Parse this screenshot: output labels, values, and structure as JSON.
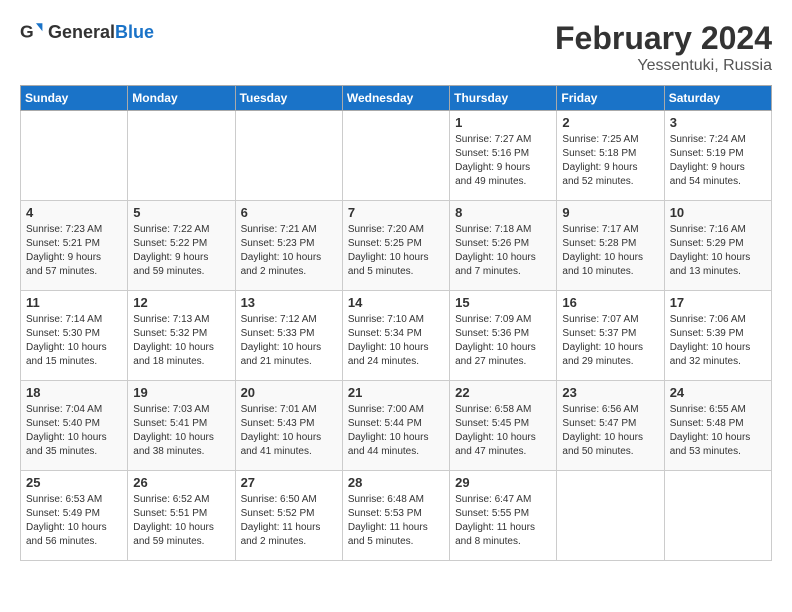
{
  "header": {
    "logo_general": "General",
    "logo_blue": "Blue",
    "month_year": "February 2024",
    "location": "Yessentuki, Russia"
  },
  "days_of_week": [
    "Sunday",
    "Monday",
    "Tuesday",
    "Wednesday",
    "Thursday",
    "Friday",
    "Saturday"
  ],
  "weeks": [
    [
      {
        "day": "",
        "info": ""
      },
      {
        "day": "",
        "info": ""
      },
      {
        "day": "",
        "info": ""
      },
      {
        "day": "",
        "info": ""
      },
      {
        "day": "1",
        "info": "Sunrise: 7:27 AM\nSunset: 5:16 PM\nDaylight: 9 hours\nand 49 minutes."
      },
      {
        "day": "2",
        "info": "Sunrise: 7:25 AM\nSunset: 5:18 PM\nDaylight: 9 hours\nand 52 minutes."
      },
      {
        "day": "3",
        "info": "Sunrise: 7:24 AM\nSunset: 5:19 PM\nDaylight: 9 hours\nand 54 minutes."
      }
    ],
    [
      {
        "day": "4",
        "info": "Sunrise: 7:23 AM\nSunset: 5:21 PM\nDaylight: 9 hours\nand 57 minutes."
      },
      {
        "day": "5",
        "info": "Sunrise: 7:22 AM\nSunset: 5:22 PM\nDaylight: 9 hours\nand 59 minutes."
      },
      {
        "day": "6",
        "info": "Sunrise: 7:21 AM\nSunset: 5:23 PM\nDaylight: 10 hours\nand 2 minutes."
      },
      {
        "day": "7",
        "info": "Sunrise: 7:20 AM\nSunset: 5:25 PM\nDaylight: 10 hours\nand 5 minutes."
      },
      {
        "day": "8",
        "info": "Sunrise: 7:18 AM\nSunset: 5:26 PM\nDaylight: 10 hours\nand 7 minutes."
      },
      {
        "day": "9",
        "info": "Sunrise: 7:17 AM\nSunset: 5:28 PM\nDaylight: 10 hours\nand 10 minutes."
      },
      {
        "day": "10",
        "info": "Sunrise: 7:16 AM\nSunset: 5:29 PM\nDaylight: 10 hours\nand 13 minutes."
      }
    ],
    [
      {
        "day": "11",
        "info": "Sunrise: 7:14 AM\nSunset: 5:30 PM\nDaylight: 10 hours\nand 15 minutes."
      },
      {
        "day": "12",
        "info": "Sunrise: 7:13 AM\nSunset: 5:32 PM\nDaylight: 10 hours\nand 18 minutes."
      },
      {
        "day": "13",
        "info": "Sunrise: 7:12 AM\nSunset: 5:33 PM\nDaylight: 10 hours\nand 21 minutes."
      },
      {
        "day": "14",
        "info": "Sunrise: 7:10 AM\nSunset: 5:34 PM\nDaylight: 10 hours\nand 24 minutes."
      },
      {
        "day": "15",
        "info": "Sunrise: 7:09 AM\nSunset: 5:36 PM\nDaylight: 10 hours\nand 27 minutes."
      },
      {
        "day": "16",
        "info": "Sunrise: 7:07 AM\nSunset: 5:37 PM\nDaylight: 10 hours\nand 29 minutes."
      },
      {
        "day": "17",
        "info": "Sunrise: 7:06 AM\nSunset: 5:39 PM\nDaylight: 10 hours\nand 32 minutes."
      }
    ],
    [
      {
        "day": "18",
        "info": "Sunrise: 7:04 AM\nSunset: 5:40 PM\nDaylight: 10 hours\nand 35 minutes."
      },
      {
        "day": "19",
        "info": "Sunrise: 7:03 AM\nSunset: 5:41 PM\nDaylight: 10 hours\nand 38 minutes."
      },
      {
        "day": "20",
        "info": "Sunrise: 7:01 AM\nSunset: 5:43 PM\nDaylight: 10 hours\nand 41 minutes."
      },
      {
        "day": "21",
        "info": "Sunrise: 7:00 AM\nSunset: 5:44 PM\nDaylight: 10 hours\nand 44 minutes."
      },
      {
        "day": "22",
        "info": "Sunrise: 6:58 AM\nSunset: 5:45 PM\nDaylight: 10 hours\nand 47 minutes."
      },
      {
        "day": "23",
        "info": "Sunrise: 6:56 AM\nSunset: 5:47 PM\nDaylight: 10 hours\nand 50 minutes."
      },
      {
        "day": "24",
        "info": "Sunrise: 6:55 AM\nSunset: 5:48 PM\nDaylight: 10 hours\nand 53 minutes."
      }
    ],
    [
      {
        "day": "25",
        "info": "Sunrise: 6:53 AM\nSunset: 5:49 PM\nDaylight: 10 hours\nand 56 minutes."
      },
      {
        "day": "26",
        "info": "Sunrise: 6:52 AM\nSunset: 5:51 PM\nDaylight: 10 hours\nand 59 minutes."
      },
      {
        "day": "27",
        "info": "Sunrise: 6:50 AM\nSunset: 5:52 PM\nDaylight: 11 hours\nand 2 minutes."
      },
      {
        "day": "28",
        "info": "Sunrise: 6:48 AM\nSunset: 5:53 PM\nDaylight: 11 hours\nand 5 minutes."
      },
      {
        "day": "29",
        "info": "Sunrise: 6:47 AM\nSunset: 5:55 PM\nDaylight: 11 hours\nand 8 minutes."
      },
      {
        "day": "",
        "info": ""
      },
      {
        "day": "",
        "info": ""
      }
    ]
  ]
}
